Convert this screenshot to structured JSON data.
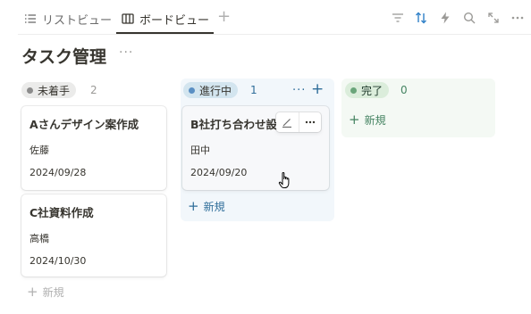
{
  "tabs": {
    "list_label": "リストビュー",
    "board_label": "ボードビュー",
    "add": "+"
  },
  "toolbar": {
    "icons": [
      "filter-icon",
      "sort-icon",
      "bolt-icon",
      "search-icon",
      "expand-icon",
      "more-icon"
    ]
  },
  "page": {
    "title": "タスク管理",
    "more": "···"
  },
  "columns": [
    {
      "label": "未着手",
      "count": "2",
      "color": "#8c8c8c",
      "pill_bg": "#ebebea",
      "cards": [
        {
          "title": "Aさんデザイン案作成",
          "person": "佐藤",
          "date": "2024/09/28"
        },
        {
          "title": "C社資料作成",
          "person": "高橋",
          "date": "2024/10/30"
        }
      ],
      "add_label": "新規"
    },
    {
      "label": "進行中",
      "count": "1",
      "color": "#5a8fc3",
      "pill_bg": "#d3e5ef",
      "cards": [
        {
          "title": "B社打ち合わせ設",
          "person": "田中",
          "date": "2024/09/20"
        }
      ],
      "add_label": "新規",
      "more": "···",
      "add": "+"
    },
    {
      "label": "完了",
      "count": "0",
      "color": "#6aa57a",
      "pill_bg": "#dbeddb",
      "cards": [],
      "add_label": "新規"
    }
  ],
  "colors": {
    "accent_blue": "#2f6e9a",
    "done_green": "#448361"
  }
}
